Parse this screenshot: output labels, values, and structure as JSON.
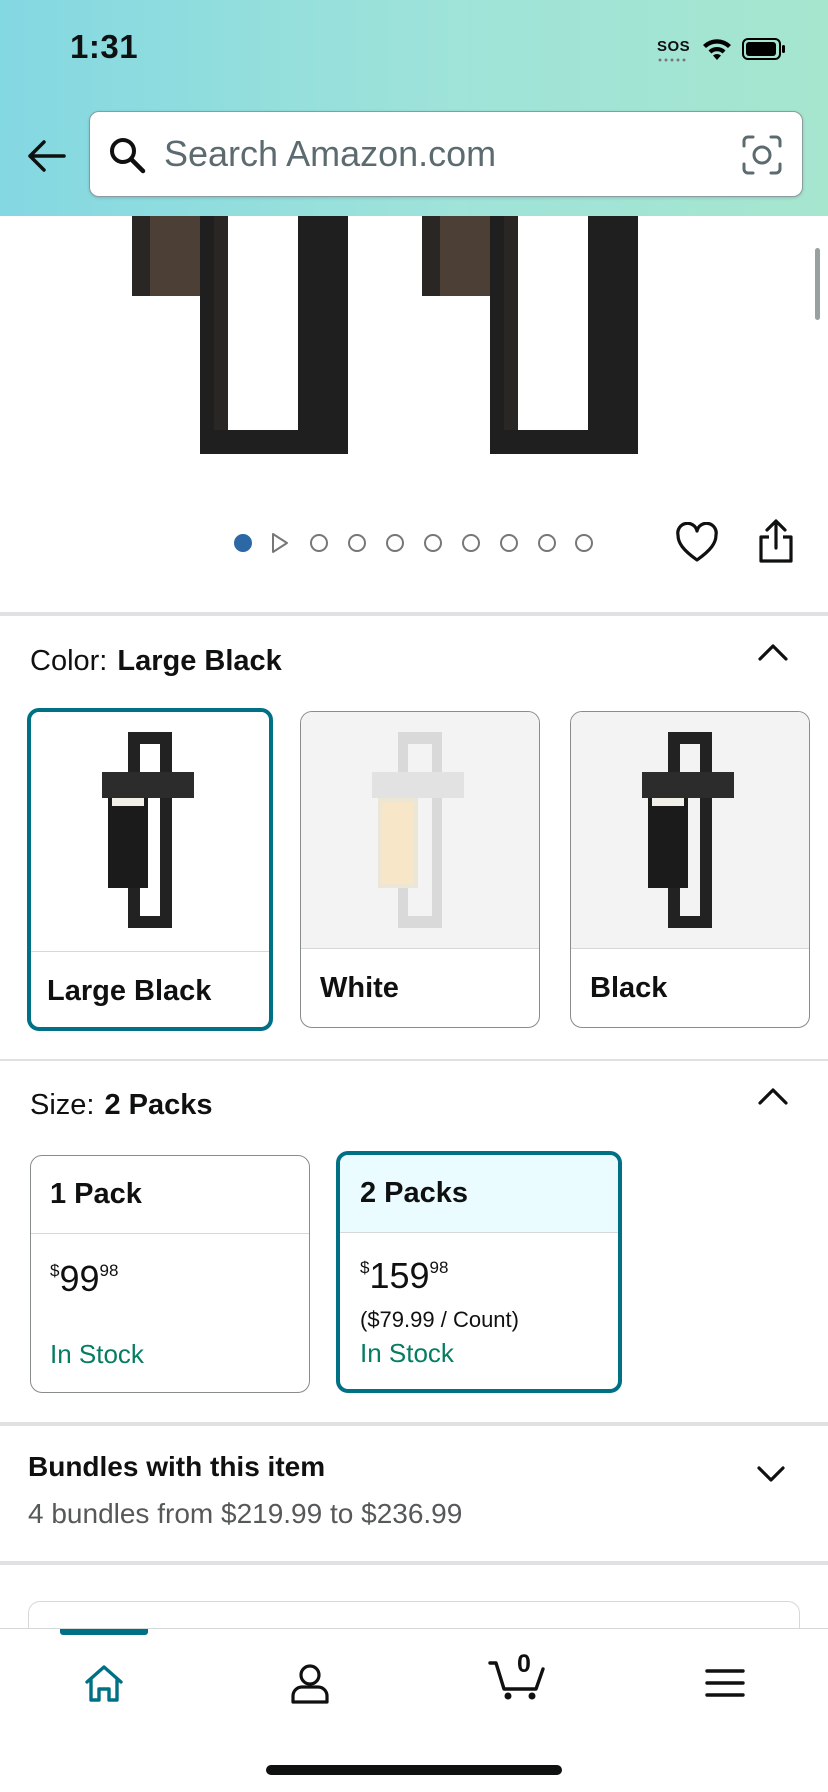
{
  "status_bar": {
    "time": "1:31",
    "sos": "SOS"
  },
  "search": {
    "placeholder": "Search Amazon.com",
    "value": ""
  },
  "gallery": {
    "image_count": 10,
    "active_index": 0
  },
  "color": {
    "label": "Color:",
    "selected": "Large Black",
    "options": [
      {
        "name": "Large Black",
        "selected": true
      },
      {
        "name": "White",
        "selected": false
      },
      {
        "name": "Black",
        "selected": false
      }
    ]
  },
  "size": {
    "label": "Size:",
    "selected": "2 Packs",
    "options": [
      {
        "name": "1 Pack",
        "price_symbol": "$",
        "price_whole": "99",
        "price_fraction": "98",
        "unit_price": "",
        "stock": "In Stock",
        "selected": false
      },
      {
        "name": "2 Packs",
        "price_symbol": "$",
        "price_whole": "159",
        "price_fraction": "98",
        "unit_price": "($79.99 / Count)",
        "stock": "In Stock",
        "selected": true
      }
    ]
  },
  "bundles": {
    "title": "Bundles with this item",
    "subtitle": "4 bundles from $219.99 to $236.99"
  },
  "bottom_nav": {
    "active": "home",
    "cart_count": "0",
    "items": [
      "home-icon",
      "account-icon",
      "cart-icon",
      "menu-icon"
    ]
  },
  "colors": {
    "accent": "#007185",
    "in_stock": "#067d62",
    "selected_dot": "#2c68a6",
    "header_start": "#84d8e2",
    "header_end": "#a6e6cf"
  }
}
